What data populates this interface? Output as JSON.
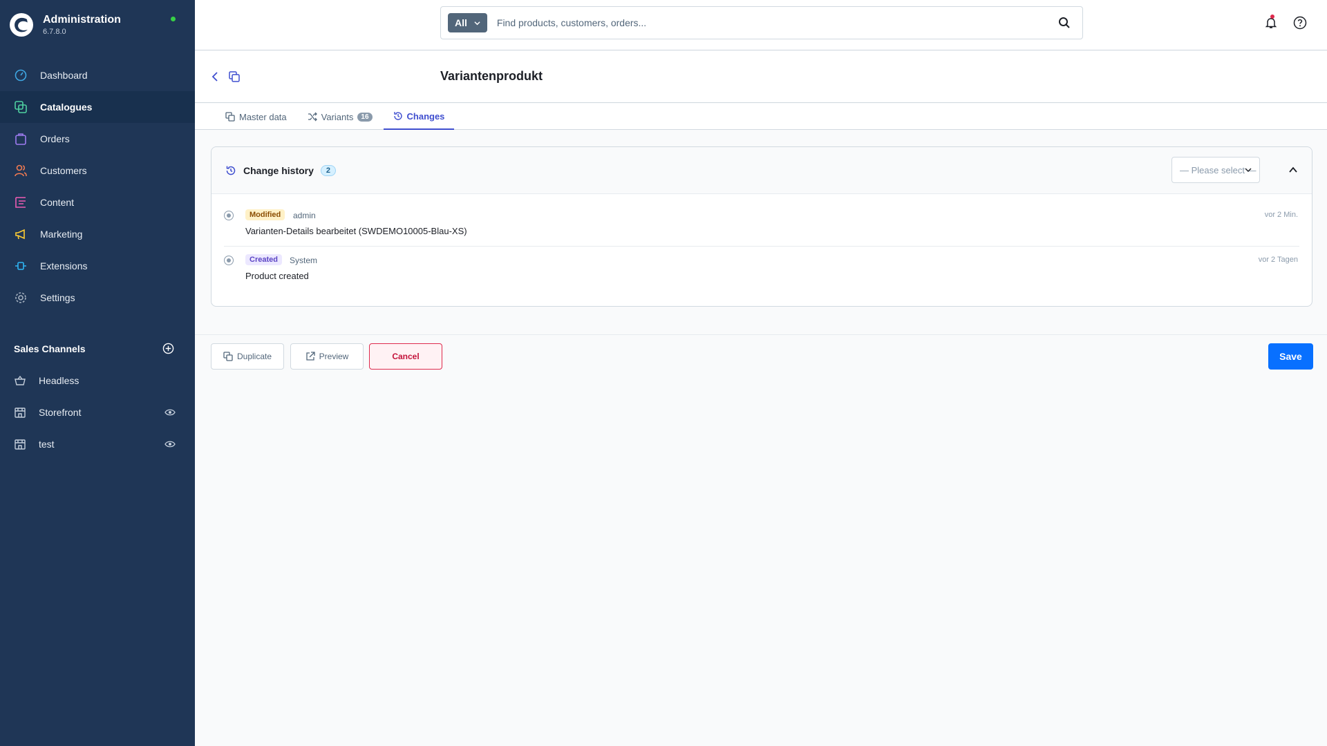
{
  "app": {
    "title": "Administration",
    "version": "6.7.8.0"
  },
  "nav": [
    {
      "label": "Dashboard",
      "icon": "dashboard-icon",
      "color": "#3fa8e4"
    },
    {
      "label": "Catalogues",
      "icon": "catalogue-icon",
      "color": "#4fd1a0"
    },
    {
      "label": "Orders",
      "icon": "orders-icon",
      "color": "#9e7bf1"
    },
    {
      "label": "Customers",
      "icon": "customers-icon",
      "color": "#f27b52"
    },
    {
      "label": "Content",
      "icon": "content-icon",
      "color": "#ee5bb4"
    },
    {
      "label": "Marketing",
      "icon": "marketing-icon",
      "color": "#ffcd34"
    },
    {
      "label": "Extensions",
      "icon": "extensions-icon",
      "color": "#2fb7f5"
    },
    {
      "label": "Settings",
      "icon": "settings-icon",
      "color": "#a4b0bf"
    }
  ],
  "sales_channels": {
    "title": "Sales Channels",
    "items": [
      {
        "label": "Headless",
        "icon": "basket-icon"
      },
      {
        "label": "Storefront",
        "icon": "storefront-icon"
      },
      {
        "label": "test",
        "icon": "storefront-icon"
      }
    ]
  },
  "search": {
    "type_label": "All",
    "placeholder": "Find products, customers, orders..."
  },
  "page": {
    "title": "Variantenprodukt"
  },
  "tabs": [
    {
      "label": "Master data"
    },
    {
      "label": "Variants",
      "badge": "16"
    },
    {
      "label": "Changes"
    }
  ],
  "history": {
    "title": "Change history",
    "count": "2",
    "select_placeholder": "— Please select —",
    "entries": [
      {
        "badge": "Modified",
        "user": "admin",
        "description": "Varianten-Details bearbeitet (SWDEMO10005-Blau-XS)",
        "time": "vor 2 Min."
      },
      {
        "badge": "Created",
        "user": "System",
        "description": "Product created",
        "time": "vor 2 Tagen"
      }
    ]
  },
  "actions": {
    "duplicate": "Duplicate",
    "preview": "Preview",
    "cancel": "Cancel",
    "save": "Save"
  },
  "colors": {
    "sidebar": "#1f3656",
    "accent": "#0870ff",
    "tab_active": "#3f4ecf",
    "cancel": "#de294c"
  }
}
